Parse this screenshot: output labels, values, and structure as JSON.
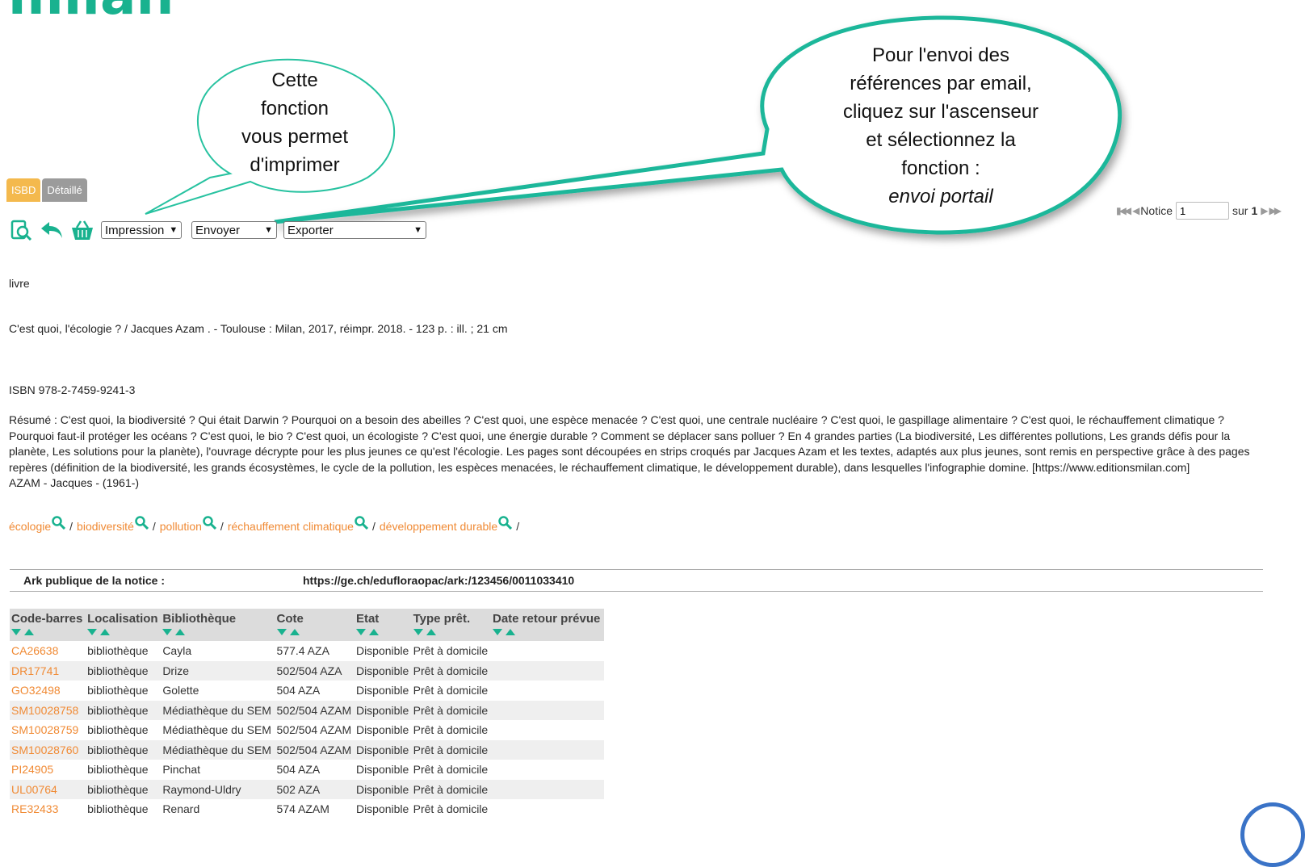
{
  "header": {
    "title": "milan"
  },
  "view_tabs": [
    "ISBD",
    "Détaillé"
  ],
  "toolbar": {
    "print_select": "Impression",
    "send_select": "Envoyer",
    "export_select": "Exporter"
  },
  "pager": {
    "label": "Notice",
    "current": "1",
    "of_label": "sur",
    "total": "1"
  },
  "callouts": {
    "print": [
      "Cette",
      "fonction",
      "vous permet",
      "d'imprimer"
    ],
    "email": [
      "Pour l'envoi des",
      "références par email,",
      "cliquez sur l'ascenseur",
      "et sélectionnez la",
      "fonction :"
    ],
    "email_italic": "envoi portail"
  },
  "record": {
    "doc_type": "livre",
    "title_line": "C'est quoi, l'écologie ?  / Jacques Azam . -   Toulouse : Milan, 2017, réimpr. 2018. - 123 p. : ill. ; 21 cm",
    "isbn": "ISBN 978-2-7459-9241-3",
    "summary": "Résumé : C'est quoi, la biodiversité ? Qui était Darwin ? Pourquoi on a besoin des abeilles ? C'est quoi, une espèce menacée ? C'est quoi, une centrale nucléaire ? C'est quoi, le gaspillage alimentaire ? C'est quoi, le réchauffement climatique ? Pourquoi faut-il protéger les océans ? C'est quoi, le bio ? C'est quoi, un écologiste ? C'est quoi, une énergie durable ? Comment se déplacer sans polluer ? En 4 grandes parties (La biodiversité, Les différentes pollutions, Les grands défis pour la planète, Les solutions pour la planète), l'ouvrage décrypte pour les plus jeunes ce qu'est l'écologie. Les pages sont découpées en strips croqués par Jacques Azam et les textes, adaptés aux plus jeunes, sont remis en perspective grâce à des pages repères (définition de la biodiversité, les grands écosystèmes, le cycle de la pollution, les espèces menacées, le réchauffement climatique, le développement durable), dans lesquelles l'infographie domine. [https://www.editionsmilan.com]",
    "author": "AZAM - Jacques - (1961-)",
    "subjects": [
      "écologie",
      "biodiversité",
      "pollution",
      "réchauffement climatique",
      "développement durable"
    ],
    "subject_separator": "/",
    "ark_label": "Ark publique de la notice :",
    "ark_url": "https://ge.ch/edufloraopac/ark:/123456/0011033410"
  },
  "copies": {
    "headers": [
      "Code-barres",
      "Localisation",
      "Bibliothèque",
      "Cote",
      "Etat",
      "Type prêt.",
      "Date retour prévue"
    ],
    "rows": [
      [
        "CA26638",
        "bibliothèque",
        "Cayla",
        "577.4 AZA",
        "Disponible",
        "Prêt à domicile",
        ""
      ],
      [
        "DR17741",
        "bibliothèque",
        "Drize",
        "502/504 AZA",
        "Disponible",
        "Prêt à domicile",
        ""
      ],
      [
        "GO32498",
        "bibliothèque",
        "Golette",
        "504 AZA",
        "Disponible",
        "Prêt à domicile",
        ""
      ],
      [
        "SM10028758",
        "bibliothèque",
        "Médiathèque du SEM",
        "502/504 AZAM",
        "Disponible",
        "Prêt à domicile",
        ""
      ],
      [
        "SM10028759",
        "bibliothèque",
        "Médiathèque du SEM",
        "502/504 AZAM",
        "Disponible",
        "Prêt à domicile",
        ""
      ],
      [
        "SM10028760",
        "bibliothèque",
        "Médiathèque du SEM",
        "502/504 AZAM",
        "Disponible",
        "Prêt à domicile",
        ""
      ],
      [
        "PI24905",
        "bibliothèque",
        "Pinchat",
        "504 AZA",
        "Disponible",
        "Prêt à domicile",
        ""
      ],
      [
        "UL00764",
        "bibliothèque",
        "Raymond-Uldry",
        "502 AZA",
        "Disponible",
        "Prêt à domicile",
        ""
      ],
      [
        "RE32433",
        "bibliothèque",
        "Renard",
        "574 AZAM",
        "Disponible",
        "Prêt à domicile",
        ""
      ]
    ]
  },
  "colors": {
    "accent_green": "#19b28f",
    "link_orange": "#f08a34",
    "tab_isbd": "#f4b94d",
    "tab_detail": "#9b9b9b"
  }
}
